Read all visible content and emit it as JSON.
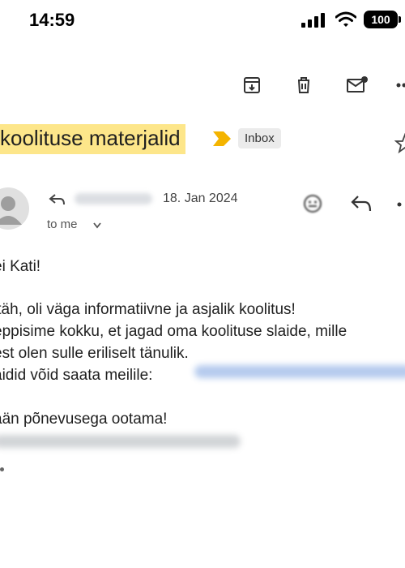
{
  "status_bar": {
    "time": "14:59",
    "battery": "100"
  },
  "toolbar": {
    "icons": [
      "archive-icon",
      "delete-icon",
      "mark-unread-icon",
      "more-icon"
    ]
  },
  "email": {
    "subject": "koolituse materjalid",
    "label": "Inbox",
    "date": "18. Jan 2024",
    "recipient": "to me",
    "greeting": "ei Kati!",
    "body_lines": [
      "itäh, oli väga informatiivne ja asjalik koolitus!",
      "eppisime kokku, et jagad oma koolituse slaide, mille",
      "est olen sulle eriliselt tänulik.",
      "aidid võid saata meilile:"
    ],
    "closing": "ään põnevusega ootama!"
  },
  "colors": {
    "subject_highlight": "#fde68a",
    "important_marker": "#f4b400",
    "chip_bg": "#ebebeb"
  }
}
